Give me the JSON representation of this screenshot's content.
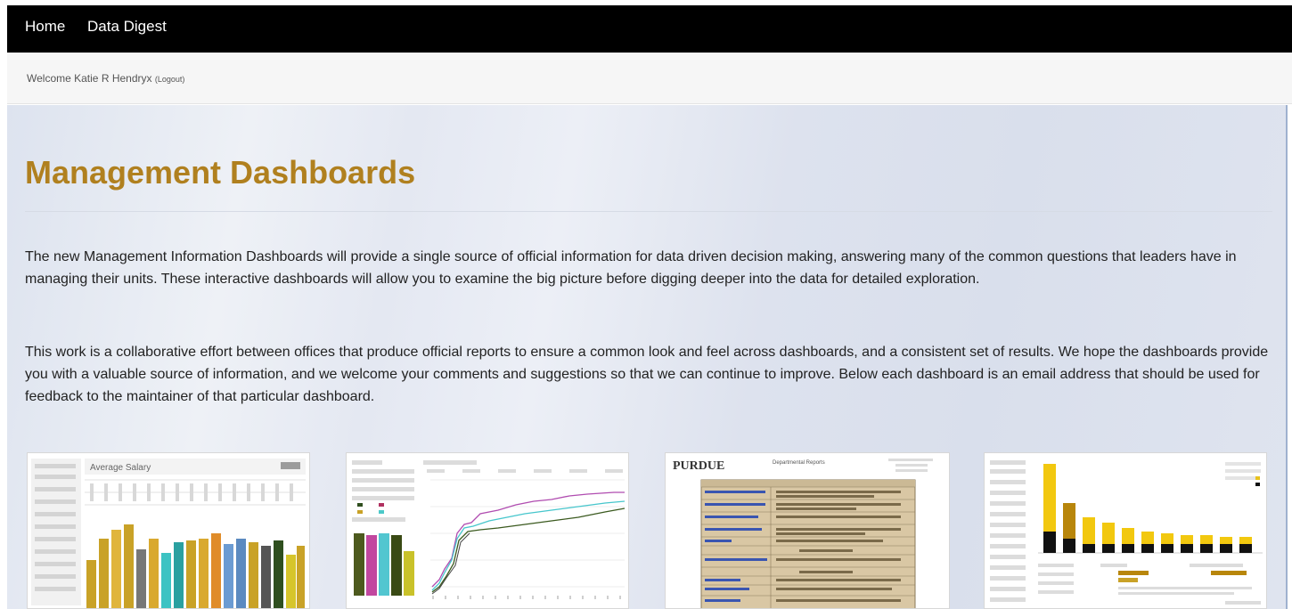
{
  "nav": {
    "home_label": "Home",
    "digest_label": "Data Digest"
  },
  "welcome": {
    "text": "Welcome Katie R Hendryx",
    "logout_label": "(Logout)"
  },
  "hero": {
    "title": "Management Dashboards",
    "paragraph1": "The new Management Information Dashboards will provide a single source of official information for data driven decision making, answering many of the common questions that leaders have in managing their units. These interactive dashboards will allow you to examine the big picture before digging deeper into the data for detailed exploration.",
    "paragraph2": "This work is a collaborative effort between offices that produce official reports to ensure a common look and feel across dashboards, and a consistent set of results. We hope the dashboards provide you with a valuable source of information, and we welcome your comments and suggestions so that we can continue to improve. Below each dashboard is an email address that should be used for feedback to the maintainer of that particular dashboard."
  },
  "thumbnails": [
    {
      "title": "Average Salary"
    },
    {
      "title": ""
    },
    {
      "title": "Departmental Reports",
      "logo": "PURDUE"
    },
    {
      "title": ""
    }
  ],
  "colors": {
    "nav_bg": "#000000",
    "title_gold": "#b0801f",
    "purdue_gold": "#c9a227"
  }
}
